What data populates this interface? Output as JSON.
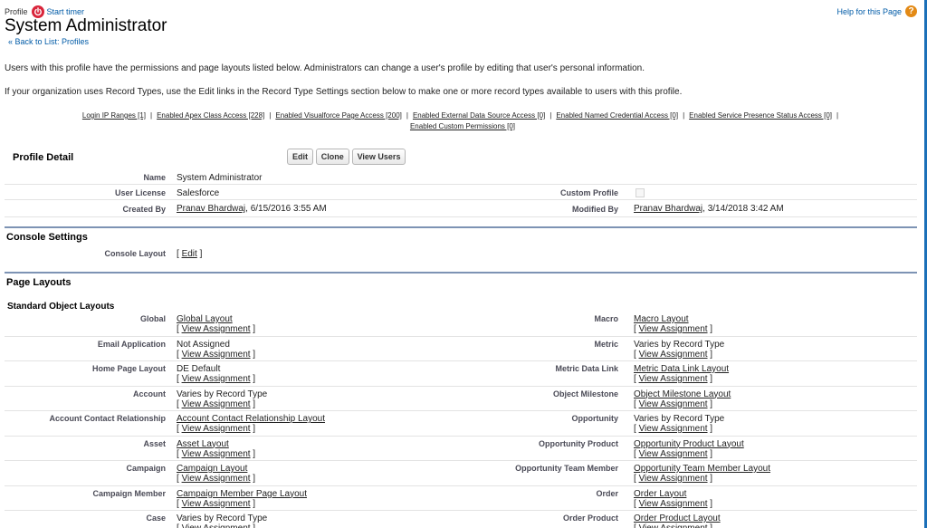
{
  "header": {
    "type_label": "Profile",
    "start_timer": "Start timer",
    "title": "System Administrator",
    "back_link": "« Back to List: Profiles",
    "help": "Help for this Page"
  },
  "description": {
    "line1": "Users with this profile have the permissions and page layouts listed below. Administrators can change a user's profile by editing that user's personal information.",
    "line2": "If your organization uses Record Types, use the Edit links in the Record Type Settings section below to make one or more record types available to users with this profile."
  },
  "related_links": {
    "login_ip": "Login IP Ranges [1]",
    "apex": "Enabled Apex Class Access [228]",
    "visualforce": "Enabled Visualforce Page Access [200]",
    "external": "Enabled External Data Source Access [0]",
    "named_cred": "Enabled Named Credential Access [0]",
    "presence": "Enabled Service Presence Status Access [0]",
    "custom_perm": "Enabled Custom Permissions [0]",
    "separator": "|"
  },
  "profile_detail": {
    "title": "Profile Detail",
    "buttons": {
      "edit": "Edit",
      "clone": "Clone",
      "view_users": "View Users"
    },
    "name_label": "Name",
    "name_value": "System Administrator",
    "license_label": "User License",
    "license_value": "Salesforce",
    "custom_label": "Custom Profile",
    "custom_checked": false,
    "created_label": "Created By",
    "created_user": "Pranav Bhardwaj",
    "created_date": ", 6/15/2016 3:55 AM",
    "modified_label": "Modified By",
    "modified_user": "Pranav Bhardwaj",
    "modified_date": ", 3/14/2018 3:42 AM"
  },
  "console": {
    "title": "Console Settings",
    "layout_label": "Console Layout",
    "edit_open": "[ ",
    "edit": "Edit",
    "edit_close": " ]"
  },
  "page_layouts": {
    "title": "Page Layouts",
    "subtitle": "Standard Object Layouts",
    "view_open": "[ ",
    "view_assignment": "View Assignment",
    "view_close": " ]",
    "left": [
      {
        "label": "Global",
        "value": "Global Layout",
        "link": true
      },
      {
        "label": "Email Application",
        "value": "Not Assigned",
        "link": false
      },
      {
        "label": "Home Page Layout",
        "value": "DE Default",
        "link": false
      },
      {
        "label": "Account",
        "value": "Varies by Record Type",
        "link": false
      },
      {
        "label": "Account Contact Relationship",
        "value": "Account Contact Relationship Layout",
        "link": true
      },
      {
        "label": "Asset",
        "value": "Asset Layout",
        "link": true
      },
      {
        "label": "Campaign",
        "value": "Campaign Layout",
        "link": true
      },
      {
        "label": "Campaign Member",
        "value": "Campaign Member Page Layout",
        "link": true
      },
      {
        "label": "Case",
        "value": "Varies by Record Type",
        "link": false
      }
    ],
    "right": [
      {
        "label": "Macro",
        "value": "Macro Layout",
        "link": true
      },
      {
        "label": "Metric",
        "value": "Varies by Record Type",
        "link": false
      },
      {
        "label": "Metric Data Link",
        "value": "Metric Data Link Layout",
        "link": true
      },
      {
        "label": "Object Milestone",
        "value": "Object Milestone Layout",
        "link": true
      },
      {
        "label": "Opportunity",
        "value": "Varies by Record Type",
        "link": false
      },
      {
        "label": "Opportunity Product",
        "value": "Opportunity Product Layout",
        "link": true
      },
      {
        "label": "Opportunity Team Member",
        "value": "Opportunity Team Member Layout",
        "link": true
      },
      {
        "label": "Order",
        "value": "Order Layout",
        "link": true
      },
      {
        "label": "Order Product",
        "value": "Order Product Layout",
        "link": true
      }
    ]
  }
}
